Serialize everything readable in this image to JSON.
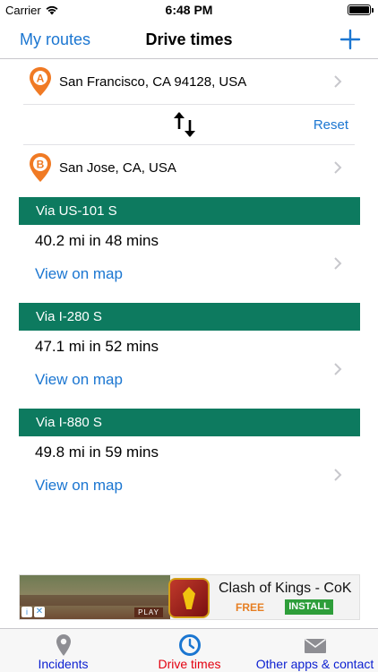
{
  "status_bar": {
    "carrier": "Carrier",
    "time": "6:48 PM"
  },
  "nav": {
    "back_label": "My routes",
    "title": "Drive times",
    "add_icon": "plus-icon"
  },
  "locations": {
    "origin": {
      "marker": "A",
      "address": "San Francisco, CA 94128, USA",
      "color": "#f07a24"
    },
    "destination": {
      "marker": "B",
      "address": "San Jose, CA, USA",
      "color": "#f07a24"
    },
    "reset_label": "Reset",
    "swap_icon": "swap-arrows-icon"
  },
  "routes": [
    {
      "via": "Via US-101 S",
      "summary": "40.2 mi in 48 mins",
      "link": "View on map"
    },
    {
      "via": "Via I-280 S",
      "summary": "47.1 mi in 52 mins",
      "link": "View on map"
    },
    {
      "via": "Via I-880 S",
      "summary": "49.8 mi in 59 mins",
      "link": "View on map"
    }
  ],
  "ad": {
    "title": "Clash of Kings - CoK",
    "price": "FREE",
    "install_label": "INSTALL",
    "play_label": "PLAY",
    "info_glyph": "i",
    "close_glyph": "✕"
  },
  "tabs": [
    {
      "label": "Incidents",
      "icon": "map-pin-icon",
      "active": false
    },
    {
      "label": "Drive times",
      "icon": "clock-icon",
      "active": true
    },
    {
      "label": "Other apps & contact",
      "icon": "envelope-icon",
      "active": false
    }
  ],
  "colors": {
    "accent": "#1b76d1",
    "route_header": "#0d7a5f",
    "marker": "#f07a24",
    "tab_active": "#e3000f",
    "tab_inactive": "#0b1fd1"
  }
}
